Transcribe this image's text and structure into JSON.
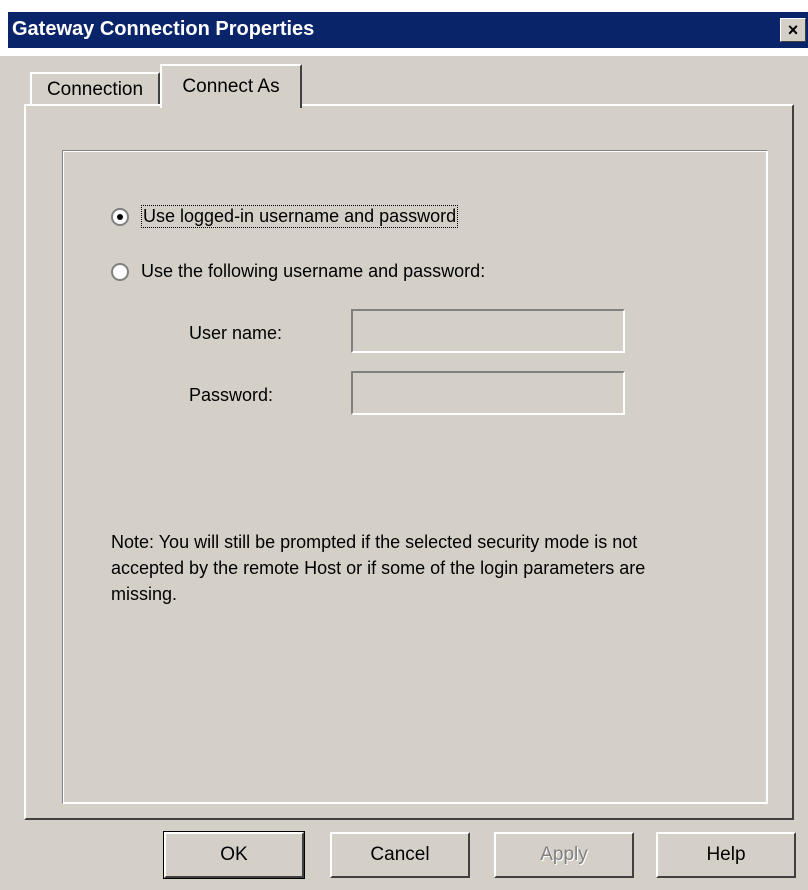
{
  "window": {
    "title": "Gateway Connection Properties"
  },
  "close_label": "×",
  "tabs": [
    {
      "label": "Connection",
      "selected": false
    },
    {
      "label": "Connect As",
      "selected": true
    }
  ],
  "options": {
    "logged_in": {
      "label": "Use logged-in username and password",
      "checked": true
    },
    "following": {
      "label": "Use the following username and password:",
      "checked": false
    }
  },
  "fields": {
    "username": {
      "label": "User name:",
      "value": ""
    },
    "password": {
      "label": "Password:",
      "value": ""
    }
  },
  "note": "Note: You will still be prompted if the selected security mode is not accepted by the remote Host or if some of the login parameters are missing.",
  "buttons": {
    "ok": "OK",
    "cancel": "Cancel",
    "apply": "Apply",
    "help": "Help"
  }
}
